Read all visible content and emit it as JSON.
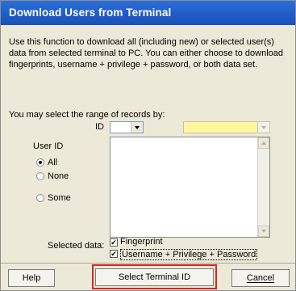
{
  "window": {
    "title": "Download Users from Terminal"
  },
  "description": "Use this function to download all (including new) or selected user(s) data from selected terminal to PC. You can either choose to download fingerprints, username + privilege + password, or both data set.",
  "range": {
    "label": "You may select the range of records by:",
    "id_label": "ID",
    "id_value": "",
    "terminal_value": ""
  },
  "user_id": {
    "label": "User ID",
    "options": [
      {
        "label": "All",
        "selected": true
      },
      {
        "label": "None",
        "selected": false
      },
      {
        "label": "Some",
        "selected": false
      }
    ]
  },
  "selected_data": {
    "label": "Selected data:",
    "items": [
      {
        "label": "Fingerprint",
        "checked": true
      },
      {
        "label": "Username + Privilege + Password",
        "checked": true
      }
    ]
  },
  "buttons": {
    "help": "Help",
    "select_terminal": "Select Terminal ID",
    "cancel": "Cancel"
  },
  "colors": {
    "title_bar": "#2163d0",
    "highlight_field": "#fff7a0",
    "annotation": "#e02020"
  },
  "icons": {
    "check": "✔"
  }
}
